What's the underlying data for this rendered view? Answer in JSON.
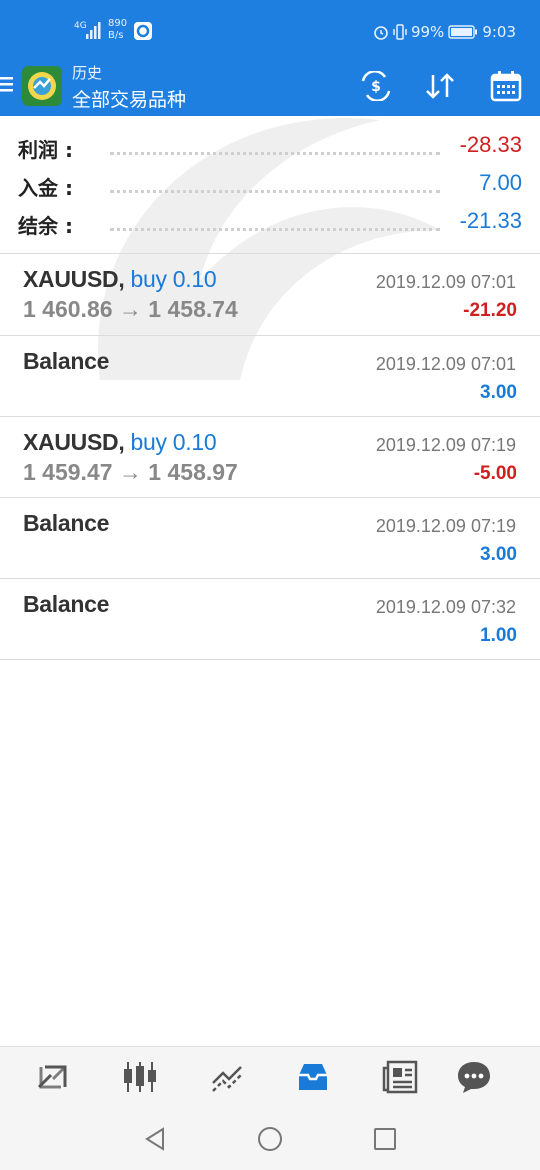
{
  "status_bar": {
    "signal_text": "4G",
    "net_speed_value": "890",
    "net_speed_unit": "B/s",
    "battery": "99%",
    "time": "9:03"
  },
  "app_bar": {
    "subtitle": "历史",
    "title": "全部交易品种",
    "icons": [
      "menu-icon",
      "app-logo",
      "currency-exchange-icon",
      "sort-icon",
      "calendar-icon"
    ]
  },
  "summary": {
    "rows": [
      {
        "label": "利润 :",
        "value": "-28.33",
        "color": "#cf1f1f"
      },
      {
        "label": "入金 :",
        "value": "7.00",
        "color": "#1a7ad8"
      },
      {
        "label": "结余 :",
        "value": "-21.33",
        "color": "#1a7ad8"
      }
    ]
  },
  "history": [
    {
      "symbol": "XAUUSD,",
      "side": "buy 0.10",
      "prices": "1 460.86 → 1 458.74",
      "time": "2019.12.09 07:01",
      "amount": "-21.20",
      "amount_color": "#cf1f1f"
    },
    {
      "symbol": "Balance",
      "side": "",
      "prices": "",
      "time": "2019.12.09 07:01",
      "amount": "3.00",
      "amount_color": "#1a7ad8"
    },
    {
      "symbol": "XAUUSD,",
      "side": "buy 0.10",
      "prices": "1 459.47 → 1 458.97",
      "time": "2019.12.09 07:19",
      "amount": "-5.00",
      "amount_color": "#cf1f1f"
    },
    {
      "symbol": "Balance",
      "side": "",
      "prices": "",
      "time": "2019.12.09 07:19",
      "amount": "3.00",
      "amount_color": "#1a7ad8"
    },
    {
      "symbol": "Balance",
      "side": "",
      "prices": "",
      "time": "2019.12.09 07:32",
      "amount": "1.00",
      "amount_color": "#1a7ad8"
    }
  ],
  "bottom_nav": {
    "items": [
      "quotes-icon",
      "chart-icon",
      "trade-icon",
      "history-icon",
      "news-icon",
      "messages-icon"
    ],
    "active": "history-icon",
    "active_color": "#1a7ad8"
  },
  "system_nav": [
    "back-icon",
    "home-icon",
    "recents-icon"
  ]
}
